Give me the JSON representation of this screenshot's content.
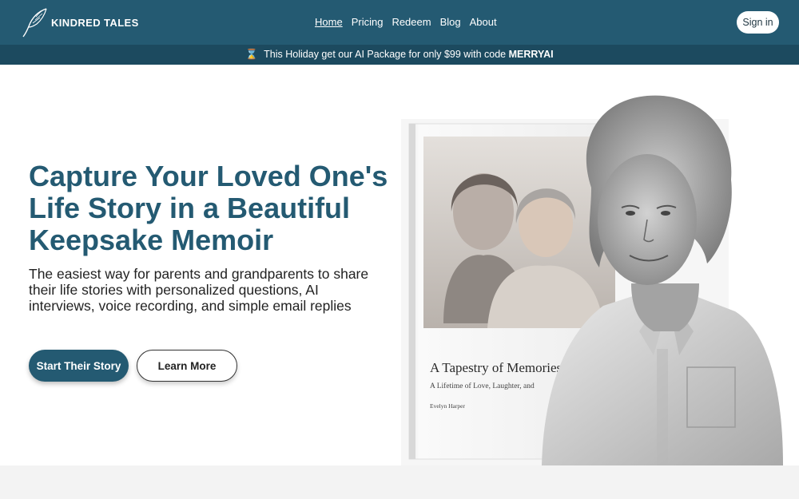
{
  "brand": {
    "name": "KINDRED TALES",
    "logo_icon": "feather-icon"
  },
  "nav": {
    "items": [
      "Home",
      "Pricing",
      "Redeem",
      "Blog",
      "About"
    ],
    "active": "Home"
  },
  "header": {
    "signin_label": "Sign in"
  },
  "promo": {
    "icon": "hourglass-icon",
    "glyph": "⌛",
    "text": "This Holiday get our AI Package for only $99 with code",
    "code": "MERRYAI"
  },
  "hero": {
    "title": "Capture Your Loved One's Life Story in a Beautiful Keepsake Memoir",
    "subtitle": "The easiest way for parents and grandparents to share their life stories with personalized questions, AI interviews, voice recording, and simple email replies",
    "primary_cta": "Start Their Story",
    "secondary_cta": "Learn More"
  },
  "book": {
    "title": "A Tapestry of Memories",
    "subtitle": "A Lifetime of Love, Laughter, and",
    "author": "Evelyn Harper"
  },
  "colors": {
    "brand": "#245a72",
    "promo_bg": "#1c4a5f",
    "text": "#222222",
    "bottom_band": "#f3f3f3"
  }
}
